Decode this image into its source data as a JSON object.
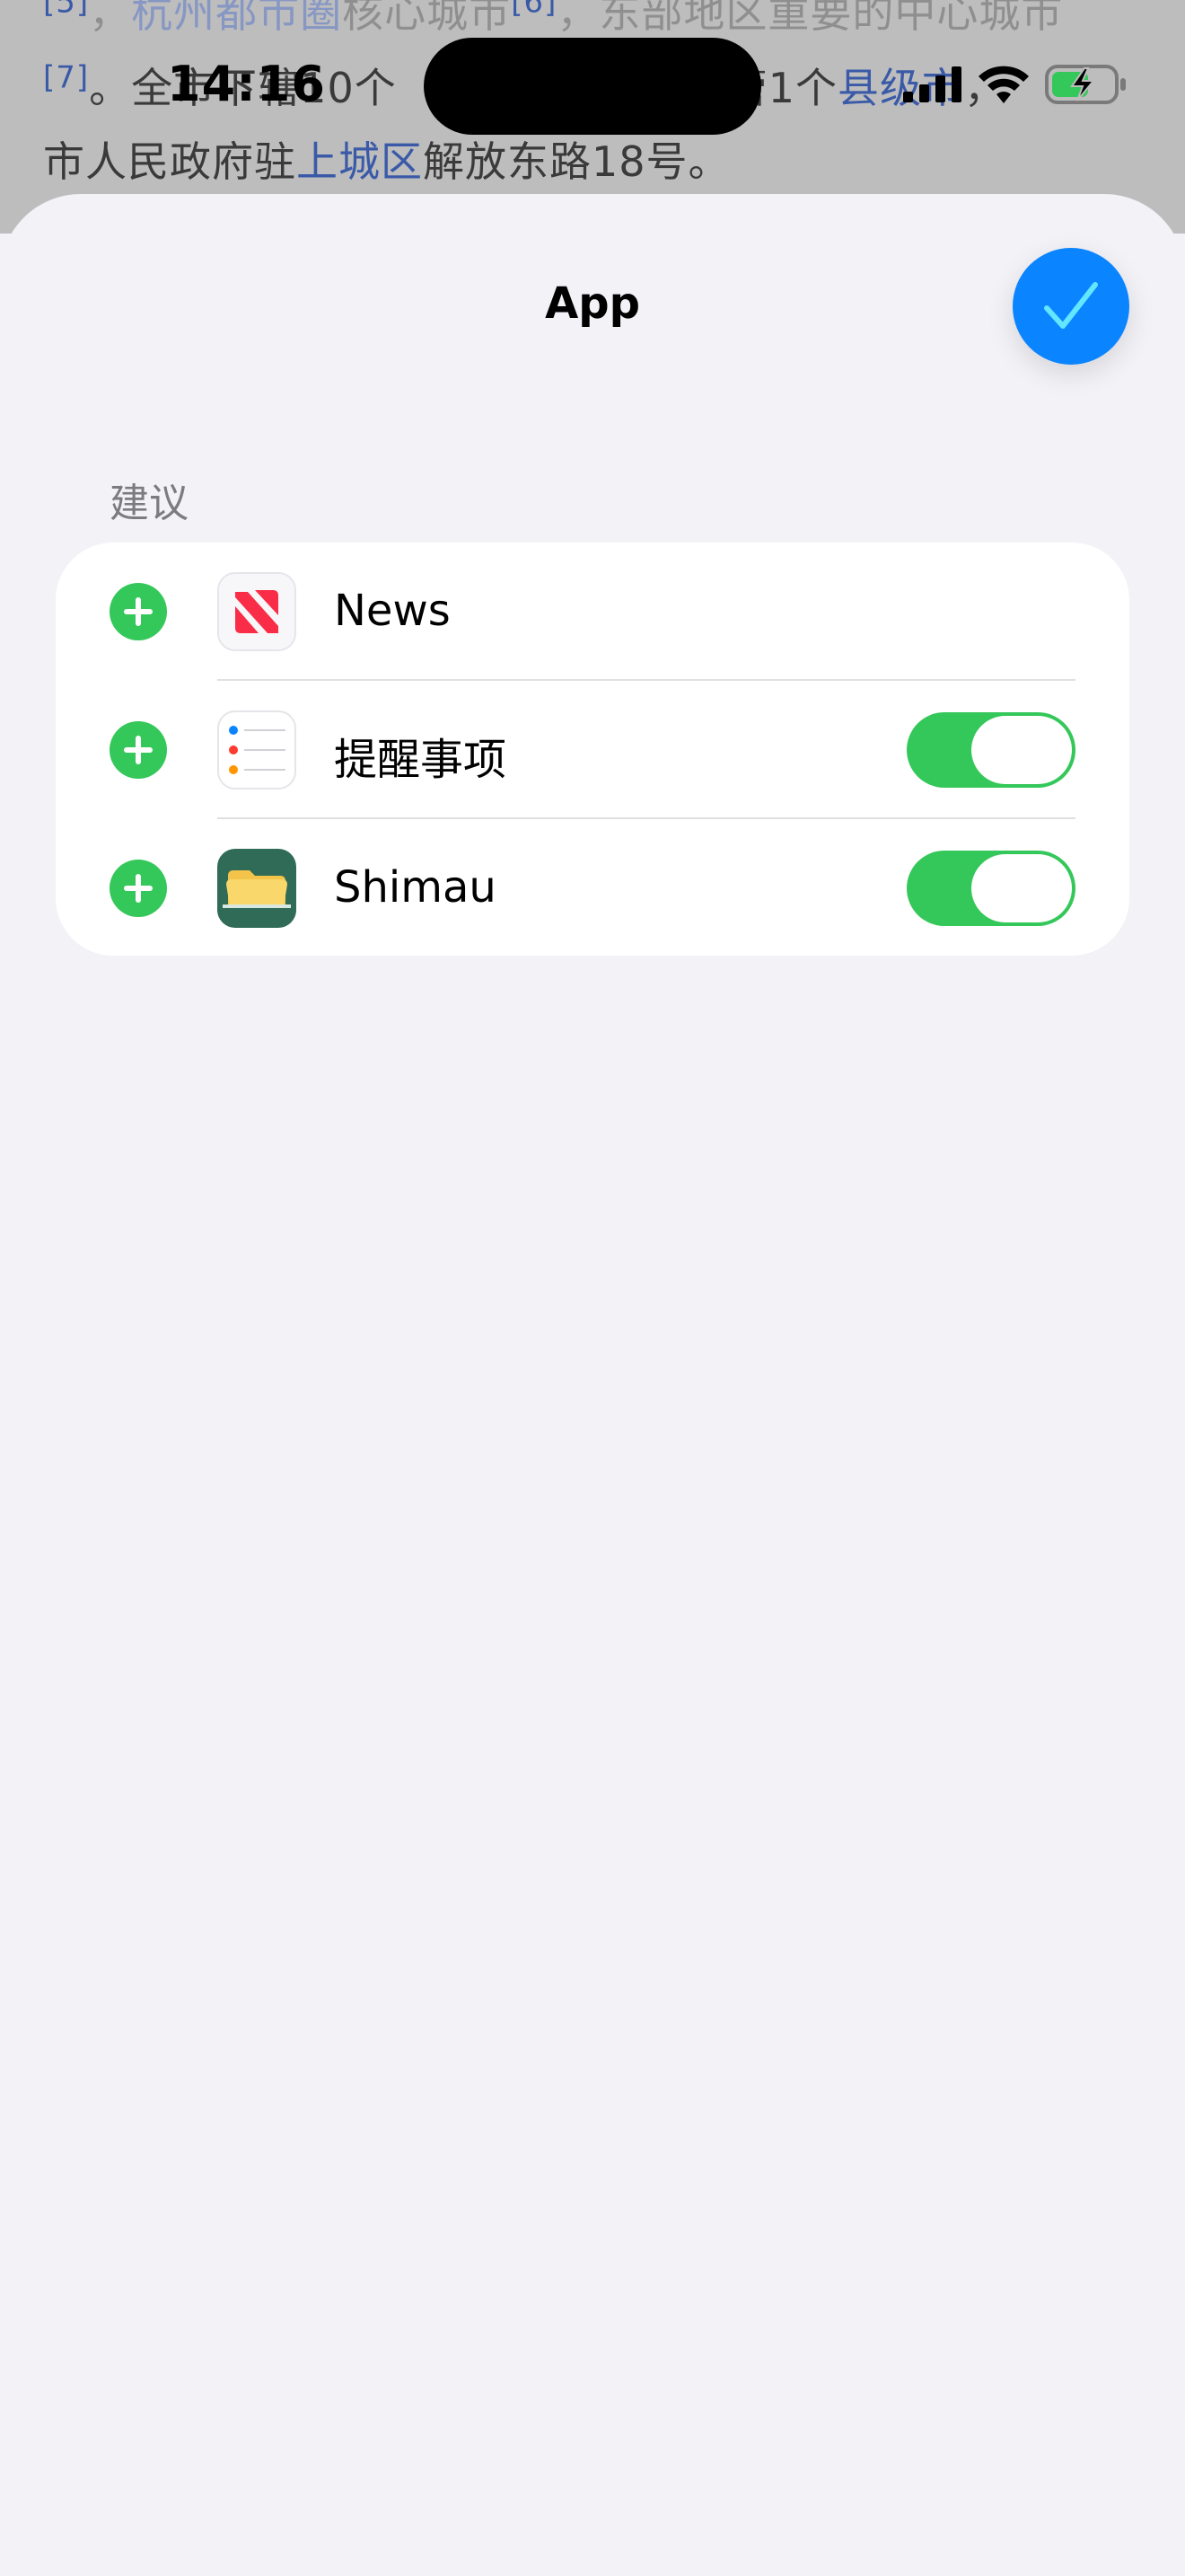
{
  "background_page": {
    "line1_parts": [
      "[5]",
      "，",
      "杭州都市圈",
      "核心城市",
      "[6]",
      "，东部地区重要的中心城市"
    ],
    "line2_parts": [
      "[7]",
      "。全市下辖10个",
      "…",
      "代管1个",
      "县级市",
      "，"
    ],
    "line3_parts": [
      "市人民政府驻",
      "上城区",
      "解放东路18号。"
    ]
  },
  "status_bar": {
    "time": "14:16"
  },
  "sheet": {
    "title": "App",
    "done_icon": "checkmark-icon",
    "section_header": "建议",
    "apps": [
      {
        "name": "News",
        "icon": "news-icon",
        "toggle": null
      },
      {
        "name": "提醒事项",
        "icon": "reminders-icon",
        "toggle": "on"
      },
      {
        "name": "Shimau",
        "icon": "shimau-icon",
        "toggle": "on"
      }
    ]
  },
  "colors": {
    "accent_blue": "#0a84ff",
    "green": "#34c759",
    "background": "#f2f2f7"
  }
}
